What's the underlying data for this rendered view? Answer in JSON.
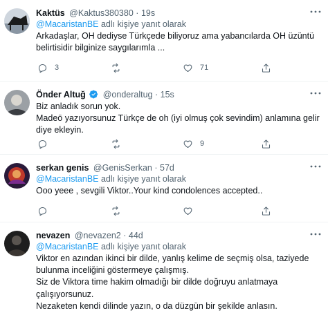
{
  "tweets": [
    {
      "name": "Kaktüs",
      "handle": "@Kaktus380380",
      "time": "19s",
      "reply_prefix": "@MacaristanBE",
      "reply_suffix": " adlı kişiye yanıt olarak",
      "lines": [
        "Arkadaşlar, OH dediyse Türkçede biliyoruz ama yabancılarda OH üzüntü",
        "belirtisidir bilginize saygılarımla ..."
      ],
      "replies": "3",
      "retweets": "",
      "likes": "71"
    },
    {
      "name": "Önder Altuğ",
      "handle": "@onderaltug",
      "time": "15s",
      "reply_prefix": "",
      "reply_suffix": "",
      "lines": [
        "Biz anladık sorun yok.",
        "Madeö yazıyorsunuz Türkçe de oh (iyi olmuş çok sevindim) anlamına gelir",
        "diye ekleyin."
      ],
      "replies": "",
      "retweets": "",
      "likes": "9"
    },
    {
      "name": "serkan genis",
      "handle": "@GenisSerkan",
      "time": "57d",
      "reply_prefix": "@MacaristanBE",
      "reply_suffix": " adlı kişiye yanıt olarak",
      "lines": [
        "Ooo yeee , sevgili Viktor..Your kind condolences accepted.."
      ],
      "replies": "",
      "retweets": "",
      "likes": ""
    },
    {
      "name": "nevazen",
      "handle": "@nevazen2",
      "time": "44d",
      "reply_prefix": "@MacaristanBE",
      "reply_suffix": " adlı kişiye yanıt olarak",
      "lines": [
        "Viktor en azından ikinci bir dilde, yanlış kelime de seçmiş olsa, taziyede",
        "bulunma inceliğini göstermeye çalışmış.",
        "Siz de Viktora time hakim olmadığı bir dilde doğruyu anlatmaya",
        "çalışıyorsunuz.",
        "Nezaketen kendi dilinde yazın, o da düzgün bir şekilde anlasın."
      ],
      "replies": "",
      "retweets": "",
      "likes": ""
    }
  ],
  "colors": {
    "text": "#0f1419",
    "secondary": "#536471",
    "link": "#1d9bf0",
    "divider": "#eff3f4"
  },
  "icons": [
    "verified-icon",
    "reply-icon",
    "retweet-icon",
    "like-icon",
    "share-icon",
    "more-icon"
  ]
}
